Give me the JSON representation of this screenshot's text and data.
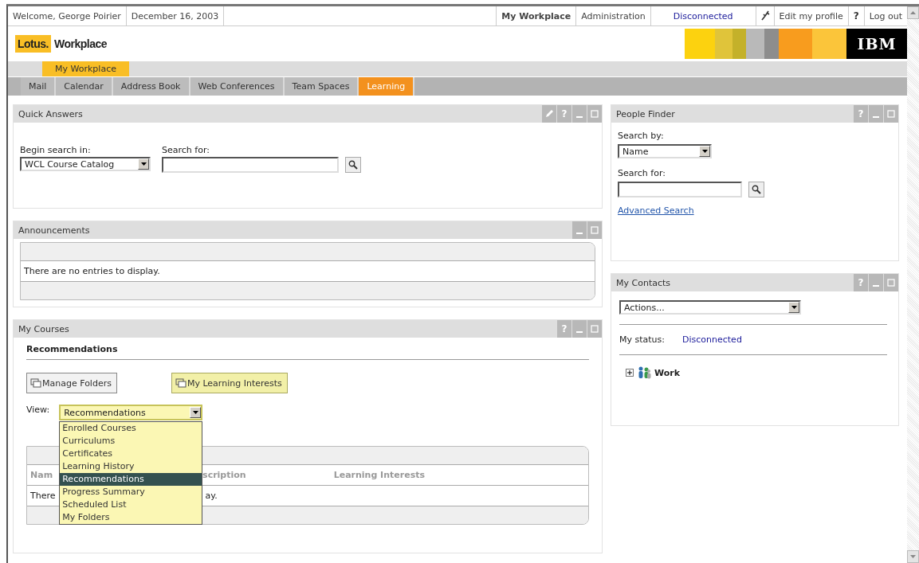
{
  "header": {
    "welcome": "Welcome, George Poirier",
    "date": "December 16, 2003",
    "links": [
      {
        "label": "My Workplace",
        "selected": true
      },
      {
        "label": "Administration",
        "selected": false
      }
    ],
    "status": "Disconnected",
    "edit_profile": "Edit my profile",
    "help": "?",
    "logout": "Log out"
  },
  "brand": {
    "lotus": "Lotus.",
    "product": "Workplace",
    "ibm": "IBM"
  },
  "place_tabs": [
    {
      "label": "My Workplace",
      "selected": true
    }
  ],
  "tabs": [
    {
      "label": "Mail",
      "selected": false
    },
    {
      "label": "Calendar",
      "selected": false
    },
    {
      "label": "Address Book",
      "selected": false
    },
    {
      "label": "Web Conferences",
      "selected": false
    },
    {
      "label": "Team Spaces",
      "selected": false
    },
    {
      "label": "Learning",
      "selected": true
    }
  ],
  "quick_answers": {
    "title": "Quick Answers",
    "controls": [
      {
        "kind": "edit"
      },
      {
        "kind": "help",
        "label": "?"
      },
      {
        "kind": "minimize"
      },
      {
        "kind": "maximize"
      }
    ],
    "scope_label": "Begin search in:",
    "scope_value": "WCL Course Catalog",
    "search_label": "Search for:"
  },
  "announcements": {
    "title": "Announcements",
    "controls": [
      {
        "kind": "minimize"
      },
      {
        "kind": "maximize"
      }
    ],
    "message": "There are no entries to display."
  },
  "my_courses": {
    "title": "My Courses",
    "controls": [
      {
        "kind": "help",
        "label": "?"
      },
      {
        "kind": "minimize"
      },
      {
        "kind": "maximize"
      }
    ],
    "heading": "Recommendations",
    "buttons": [
      {
        "label": "Manage Folders",
        "highlighted": false
      },
      {
        "label": "My Learning Interests",
        "highlighted": true
      }
    ],
    "view_label": "View:",
    "view_value": "Recommendations",
    "view_options": [
      {
        "label": "Enrolled Courses",
        "selected": false
      },
      {
        "label": "Curriculums",
        "selected": false
      },
      {
        "label": "Certificates",
        "selected": false
      },
      {
        "label": "Learning History",
        "selected": false
      },
      {
        "label": "Recommendations",
        "selected": true
      },
      {
        "label": "Progress Summary",
        "selected": false
      },
      {
        "label": "Scheduled List",
        "selected": false
      },
      {
        "label": "My Folders",
        "selected": false
      }
    ],
    "columns": [
      "Nam",
      "scription",
      "Learning Interests"
    ],
    "message_parts": [
      "There",
      "ay."
    ]
  },
  "people_finder": {
    "title": "People Finder",
    "controls": [
      {
        "kind": "help",
        "label": "?"
      },
      {
        "kind": "minimize"
      },
      {
        "kind": "maximize"
      }
    ],
    "search_by_label": "Search by:",
    "search_by_value": "Name",
    "search_label": "Search for:",
    "advanced_link": "Advanced Search"
  },
  "my_contacts": {
    "title": "My Contacts",
    "controls": [
      {
        "kind": "help",
        "label": "?"
      },
      {
        "kind": "minimize"
      },
      {
        "kind": "maximize"
      }
    ],
    "actions_value": "Actions...",
    "status_label": "My status:",
    "status_value": "Disconnected",
    "groups": [
      {
        "label": "Work",
        "expanded": false
      }
    ]
  }
}
